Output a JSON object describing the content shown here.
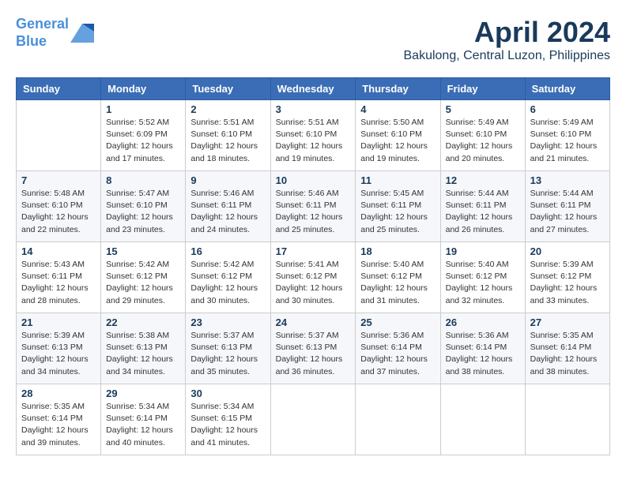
{
  "header": {
    "logo_line1": "General",
    "logo_line2": "Blue",
    "month_title": "April 2024",
    "location": "Bakulong, Central Luzon, Philippines"
  },
  "calendar": {
    "days_of_week": [
      "Sunday",
      "Monday",
      "Tuesday",
      "Wednesday",
      "Thursday",
      "Friday",
      "Saturday"
    ],
    "weeks": [
      [
        {
          "day": "",
          "info": ""
        },
        {
          "day": "1",
          "info": "Sunrise: 5:52 AM\nSunset: 6:09 PM\nDaylight: 12 hours\nand 17 minutes."
        },
        {
          "day": "2",
          "info": "Sunrise: 5:51 AM\nSunset: 6:10 PM\nDaylight: 12 hours\nand 18 minutes."
        },
        {
          "day": "3",
          "info": "Sunrise: 5:51 AM\nSunset: 6:10 PM\nDaylight: 12 hours\nand 19 minutes."
        },
        {
          "day": "4",
          "info": "Sunrise: 5:50 AM\nSunset: 6:10 PM\nDaylight: 12 hours\nand 19 minutes."
        },
        {
          "day": "5",
          "info": "Sunrise: 5:49 AM\nSunset: 6:10 PM\nDaylight: 12 hours\nand 20 minutes."
        },
        {
          "day": "6",
          "info": "Sunrise: 5:49 AM\nSunset: 6:10 PM\nDaylight: 12 hours\nand 21 minutes."
        }
      ],
      [
        {
          "day": "7",
          "info": "Sunrise: 5:48 AM\nSunset: 6:10 PM\nDaylight: 12 hours\nand 22 minutes."
        },
        {
          "day": "8",
          "info": "Sunrise: 5:47 AM\nSunset: 6:10 PM\nDaylight: 12 hours\nand 23 minutes."
        },
        {
          "day": "9",
          "info": "Sunrise: 5:46 AM\nSunset: 6:11 PM\nDaylight: 12 hours\nand 24 minutes."
        },
        {
          "day": "10",
          "info": "Sunrise: 5:46 AM\nSunset: 6:11 PM\nDaylight: 12 hours\nand 25 minutes."
        },
        {
          "day": "11",
          "info": "Sunrise: 5:45 AM\nSunset: 6:11 PM\nDaylight: 12 hours\nand 25 minutes."
        },
        {
          "day": "12",
          "info": "Sunrise: 5:44 AM\nSunset: 6:11 PM\nDaylight: 12 hours\nand 26 minutes."
        },
        {
          "day": "13",
          "info": "Sunrise: 5:44 AM\nSunset: 6:11 PM\nDaylight: 12 hours\nand 27 minutes."
        }
      ],
      [
        {
          "day": "14",
          "info": "Sunrise: 5:43 AM\nSunset: 6:11 PM\nDaylight: 12 hours\nand 28 minutes."
        },
        {
          "day": "15",
          "info": "Sunrise: 5:42 AM\nSunset: 6:12 PM\nDaylight: 12 hours\nand 29 minutes."
        },
        {
          "day": "16",
          "info": "Sunrise: 5:42 AM\nSunset: 6:12 PM\nDaylight: 12 hours\nand 30 minutes."
        },
        {
          "day": "17",
          "info": "Sunrise: 5:41 AM\nSunset: 6:12 PM\nDaylight: 12 hours\nand 30 minutes."
        },
        {
          "day": "18",
          "info": "Sunrise: 5:40 AM\nSunset: 6:12 PM\nDaylight: 12 hours\nand 31 minutes."
        },
        {
          "day": "19",
          "info": "Sunrise: 5:40 AM\nSunset: 6:12 PM\nDaylight: 12 hours\nand 32 minutes."
        },
        {
          "day": "20",
          "info": "Sunrise: 5:39 AM\nSunset: 6:12 PM\nDaylight: 12 hours\nand 33 minutes."
        }
      ],
      [
        {
          "day": "21",
          "info": "Sunrise: 5:39 AM\nSunset: 6:13 PM\nDaylight: 12 hours\nand 34 minutes."
        },
        {
          "day": "22",
          "info": "Sunrise: 5:38 AM\nSunset: 6:13 PM\nDaylight: 12 hours\nand 34 minutes."
        },
        {
          "day": "23",
          "info": "Sunrise: 5:37 AM\nSunset: 6:13 PM\nDaylight: 12 hours\nand 35 minutes."
        },
        {
          "day": "24",
          "info": "Sunrise: 5:37 AM\nSunset: 6:13 PM\nDaylight: 12 hours\nand 36 minutes."
        },
        {
          "day": "25",
          "info": "Sunrise: 5:36 AM\nSunset: 6:14 PM\nDaylight: 12 hours\nand 37 minutes."
        },
        {
          "day": "26",
          "info": "Sunrise: 5:36 AM\nSunset: 6:14 PM\nDaylight: 12 hours\nand 38 minutes."
        },
        {
          "day": "27",
          "info": "Sunrise: 5:35 AM\nSunset: 6:14 PM\nDaylight: 12 hours\nand 38 minutes."
        }
      ],
      [
        {
          "day": "28",
          "info": "Sunrise: 5:35 AM\nSunset: 6:14 PM\nDaylight: 12 hours\nand 39 minutes."
        },
        {
          "day": "29",
          "info": "Sunrise: 5:34 AM\nSunset: 6:14 PM\nDaylight: 12 hours\nand 40 minutes."
        },
        {
          "day": "30",
          "info": "Sunrise: 5:34 AM\nSunset: 6:15 PM\nDaylight: 12 hours\nand 41 minutes."
        },
        {
          "day": "",
          "info": ""
        },
        {
          "day": "",
          "info": ""
        },
        {
          "day": "",
          "info": ""
        },
        {
          "day": "",
          "info": ""
        }
      ]
    ]
  }
}
